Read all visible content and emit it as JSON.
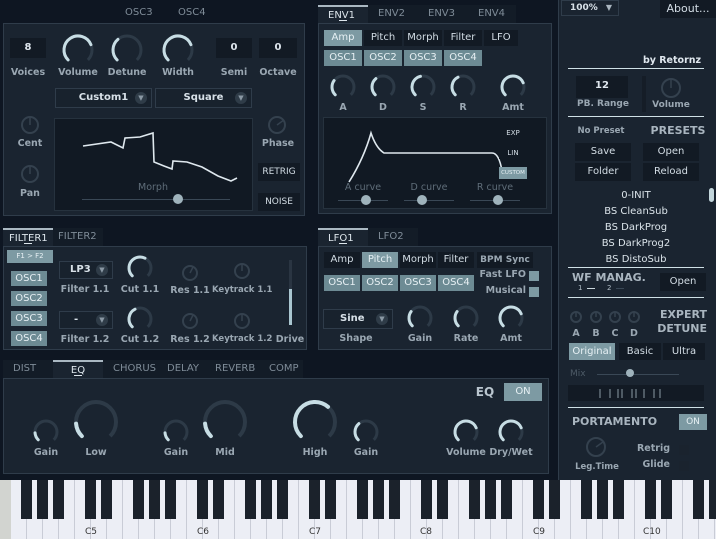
{
  "header": {
    "zoom_select": "100%",
    "about_button": "About...",
    "credit": "by Retornz"
  },
  "osc": {
    "tabs": [
      "OSC3",
      "OSC4"
    ],
    "voices": {
      "label": "Voices",
      "value": "8"
    },
    "volume": {
      "label": "Volume",
      "value": 0.75
    },
    "detune": {
      "label": "Detune",
      "value": 0.35
    },
    "width": {
      "label": "Width",
      "value": 0.75
    },
    "semi": {
      "label": "Semi",
      "value": "0"
    },
    "octave": {
      "label": "Octave",
      "value": "0"
    },
    "wavetable_select": "Custom1",
    "waveform_select": "Square",
    "cent": {
      "label": "Cent",
      "value": 0.5
    },
    "pan": {
      "label": "Pan",
      "value": 0.5
    },
    "phase": {
      "label": "Phase",
      "value": 0.7
    },
    "morph_label": "Morph",
    "morph_value": 0.65,
    "retrig_button": "RETRIG",
    "noise_button": "NOISE"
  },
  "env": {
    "tabs": [
      "ENV1",
      "ENV2",
      "ENV3",
      "ENV4"
    ],
    "active_tab": "ENV1",
    "targets": [
      "Amp",
      "Pitch",
      "Morph",
      "Filter",
      "LFO"
    ],
    "active_target": "Amp",
    "oscs": [
      "OSC1",
      "OSC2",
      "OSC3",
      "OSC4"
    ],
    "knobs": [
      {
        "label": "A",
        "value": 0.3
      },
      {
        "label": "D",
        "value": 0.35
      },
      {
        "label": "S",
        "value": 0.45
      },
      {
        "label": "R",
        "value": 0.4
      },
      {
        "label": "Amt",
        "value": 0.75
      }
    ],
    "curve_modes": [
      "EXP",
      "LIN",
      "CUSTOM"
    ],
    "active_curve_mode": "CUSTOM",
    "curves": [
      {
        "label": "A curve",
        "value": 0.55
      },
      {
        "label": "D curve",
        "value": 0.35
      },
      {
        "label": "R curve",
        "value": 0.55
      }
    ]
  },
  "filter": {
    "tabs": [
      "FILTER1",
      "FILTER2"
    ],
    "active_tab": "FILTER1",
    "routing_button": "F1 > F2",
    "oscs": [
      "OSC1",
      "OSC2",
      "OSC3",
      "OSC4"
    ],
    "filter11": {
      "select": "LP3",
      "label": "Filter 1.1"
    },
    "filter12": {
      "select": "-",
      "label": "Filter 1.2"
    },
    "cut11": {
      "label": "Cut 1.1",
      "value": 0.6
    },
    "res11": {
      "label": "Res 1.1",
      "value": 0.6
    },
    "keytrack11": {
      "label": "Keytrack 1.1",
      "value": 0.5
    },
    "cut12": {
      "label": "Cut 1.2",
      "value": 0.4
    },
    "res12": {
      "label": "Res 1.2",
      "value": 0.6
    },
    "keytrack12": {
      "label": "Keytrack 1.2",
      "value": 0.5
    },
    "drive": {
      "label": "Drive",
      "value": 0.55
    }
  },
  "lfo": {
    "tabs": [
      "LFO1",
      "LFO2"
    ],
    "active_tab": "LFO1",
    "targets": [
      "Amp",
      "Pitch",
      "Morph",
      "Filter"
    ],
    "active_target": "Pitch",
    "bpm_sync": "BPM Sync",
    "oscs": [
      "OSC1",
      "OSC2",
      "OSC3",
      "OSC4"
    ],
    "fast_lfo": {
      "label": "Fast LFO",
      "checked": true
    },
    "musical": {
      "label": "Musical",
      "checked": true
    },
    "shape_select": "Sine",
    "shape_label": "Shape",
    "gain": {
      "label": "Gain",
      "value": 0.3
    },
    "rate": {
      "label": "Rate",
      "value": 0.3
    },
    "amt": {
      "label": "Amt",
      "value": 0.75
    }
  },
  "fx": {
    "tabs": [
      "DIST",
      "EQ",
      "CHORUS",
      "DELAY",
      "REVERB",
      "COMP"
    ],
    "active_tab": "EQ",
    "title": "EQ",
    "toggle": "ON",
    "knobs": [
      {
        "label": "Gain",
        "value": 0.15
      },
      {
        "label": "Low",
        "value": 0.15
      },
      {
        "label": "Gain",
        "value": 0.15
      },
      {
        "label": "Mid",
        "value": 0.15
      },
      {
        "label": "High",
        "value": 0.65
      },
      {
        "label": "Gain",
        "value": 0.35
      },
      {
        "label": "Volume",
        "value": 0.75
      },
      {
        "label": "Dry/Wet",
        "value": 0.75
      }
    ]
  },
  "sidebar": {
    "pb_range": {
      "label": "PB. Range",
      "value": "12"
    },
    "volume": {
      "label": "Volume",
      "value": 0.5
    },
    "preset_name": "No Preset",
    "presets_title": "PRESETS",
    "save": "Save",
    "open": "Open",
    "folder": "Folder",
    "reload": "Reload",
    "preset_list": [
      "0-INIT",
      "BS CleanSub",
      "BS DarkProg",
      "BS DarkProg2",
      "BS DistoSub"
    ],
    "wf_manag": {
      "title": "WF MANAG.",
      "page1": "1",
      "page2": "2",
      "open": "Open"
    },
    "expert_detune": {
      "title1": "EXPERT",
      "title2": "DETUNE",
      "knobs": [
        "A",
        "B",
        "C",
        "D"
      ]
    },
    "detune_modes": [
      "Original",
      "Basic",
      "Ultra"
    ],
    "active_detune_mode": "Original",
    "mix_label": "Mix",
    "mix_value": 0.4,
    "portamento": {
      "title": "PORTAMENTO",
      "toggle": "ON",
      "leg_time": "Leg.Time",
      "retrig": "Retrig",
      "glide": "Glide"
    }
  },
  "keyboard": {
    "octave_labels": [
      "C5",
      "C6",
      "C7",
      "C8",
      "C9",
      "C10"
    ]
  }
}
